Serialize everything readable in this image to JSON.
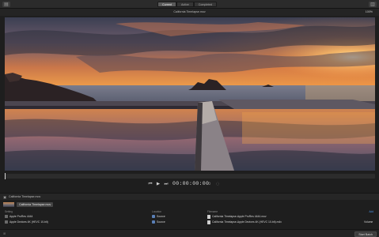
{
  "toolbar": {
    "left_icon": "sidebar-icon",
    "right_icon": "inspector-icon",
    "tabs": [
      {
        "label": "Current",
        "active": true
      },
      {
        "label": "Active",
        "active": false
      },
      {
        "label": "Completed",
        "active": false
      }
    ]
  },
  "viewer": {
    "title": "California Timelapse.mov",
    "zoom": "100%"
  },
  "transport": {
    "prev_icon": "skip-back-icon",
    "play_icon": "play-icon",
    "next_icon": "skip-forward-icon",
    "timecode": "00:00:00:00",
    "loop_icon": "loop-icon",
    "extra_icon": "markers-icon",
    "playhead_fraction": 0.0
  },
  "batch": {
    "header_icon": "disclosure-icon",
    "title": "California Timelapse.mov",
    "job_name": "California Timelapse.mov",
    "columns": {
      "setting": "Setting",
      "location": "Location",
      "filename": "Filename",
      "add": "Add"
    },
    "outputs": [
      {
        "setting": "Apple ProRes 4444",
        "location": "Source",
        "filename": "California Timelapse-Apple ProRes 4444.mov",
        "extra": ""
      },
      {
        "setting": "Apple Devices 4K (HEVC 10-bit)",
        "location": "Source",
        "filename": "California Timelapse-Apple Devices 4K (HEVC 10-bit).m4v",
        "extra": "Volume"
      }
    ]
  },
  "bottom": {
    "left_icon": "add-icon",
    "start_batch": "Start Batch"
  },
  "colors": {
    "accent": "#4a90e2",
    "background": "#1e1e1e"
  }
}
